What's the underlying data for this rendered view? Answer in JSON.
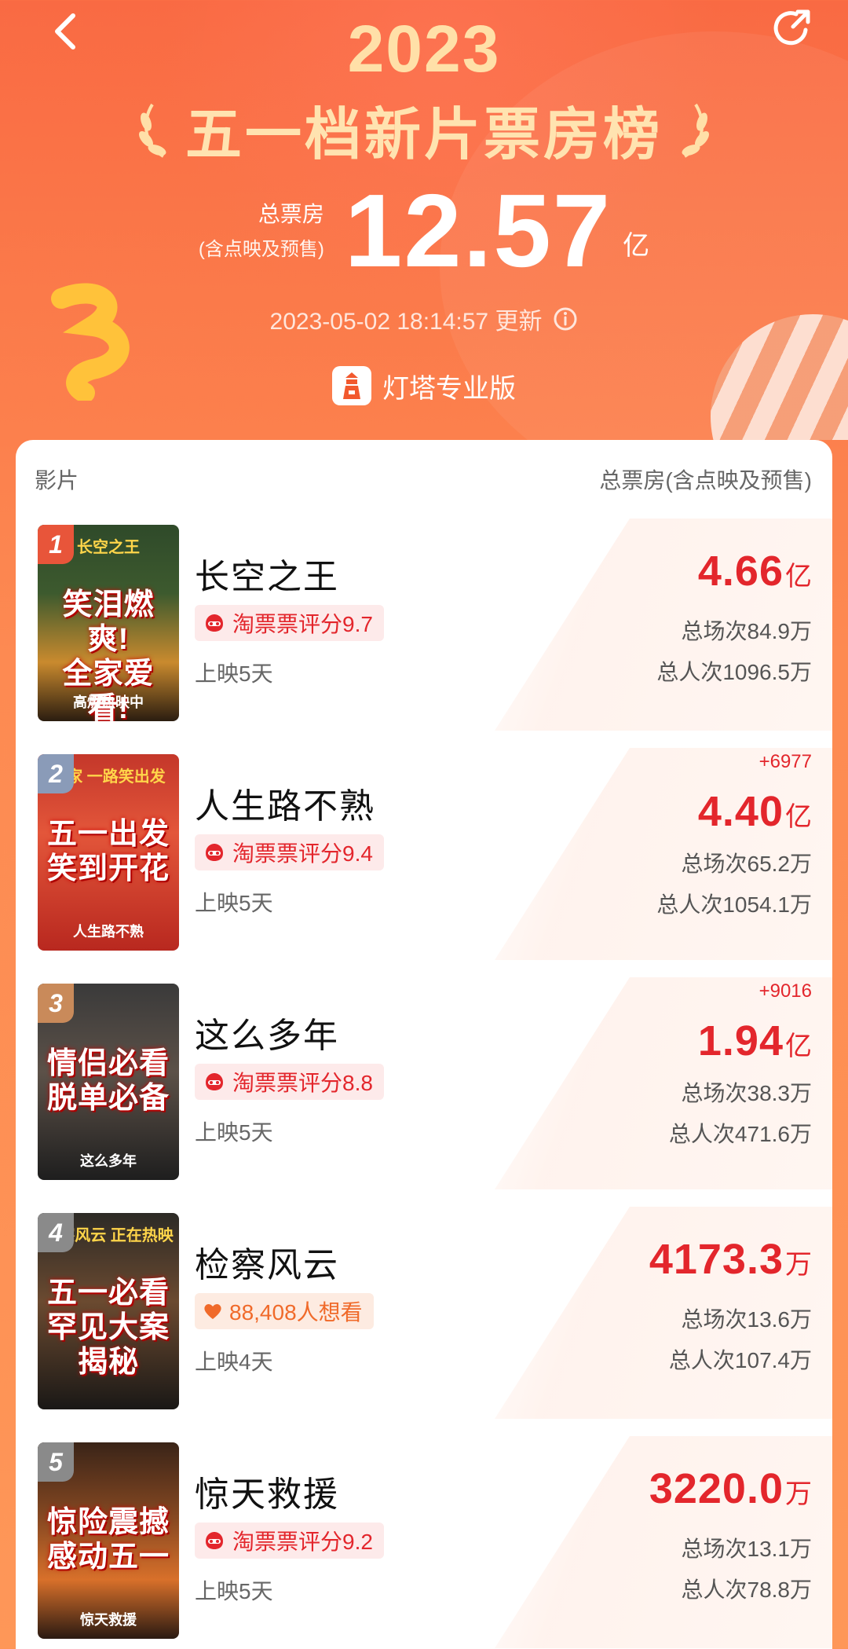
{
  "header": {
    "year": "2023",
    "title": "五一档新片票房榜",
    "total_label": "总票房",
    "total_sublabel": "(含点映及预售)",
    "total_value": "12.57",
    "total_unit": "亿",
    "updated": "2023-05-02 18:14:57 更新",
    "brand": "灯塔专业版"
  },
  "list": {
    "col_film": "影片",
    "col_gross": "总票房(含点映及预售)",
    "movies": [
      {
        "rank": "1",
        "rank_color": "#e8553a",
        "title": "长空之王",
        "badge": "淘票票评分9.7",
        "badge_type": "rating",
        "days": "上映5天",
        "delta": "",
        "gross": "4.66",
        "gross_unit": "亿",
        "shows": "总场次84.9万",
        "admissions": "总人次1096.5万",
        "poster": {
          "top": "长空之王",
          "text": "笑泪燃爽!\n全家爱看!",
          "sub": "高燃热映中"
        }
      },
      {
        "rank": "2",
        "rank_color": "#8a9bb8",
        "title": "人生路不熟",
        "badge": "淘票票评分9.4",
        "badge_type": "rating",
        "days": "上映5天",
        "delta": "+6977",
        "gross": "4.40",
        "gross_unit": "亿",
        "shows": "总场次65.2万",
        "admissions": "总人次1054.1万",
        "poster": {
          "top": "一家 一路笑出发",
          "text": "五一出发\n笑到开花",
          "sub": "人生路不熟"
        }
      },
      {
        "rank": "3",
        "rank_color": "#c98a5a",
        "title": "这么多年",
        "badge": "淘票票评分8.8",
        "badge_type": "rating",
        "days": "上映5天",
        "delta": "+9016",
        "gross": "1.94",
        "gross_unit": "亿",
        "shows": "总场次38.3万",
        "admissions": "总人次471.6万",
        "poster": {
          "top": "",
          "text": "情侣必看\n脱单必备",
          "sub": "这么多年"
        }
      },
      {
        "rank": "4",
        "rank_color": "#8a8a8a",
        "title": "检察风云",
        "badge": "88,408人想看",
        "badge_type": "want",
        "days": "上映4天",
        "delta": "",
        "gross": "4173.3",
        "gross_unit": "万",
        "shows": "总场次13.6万",
        "admissions": "总人次107.4万",
        "poster": {
          "top": "检察风云 正在热映",
          "text": "五一必看\n罕见大案揭秘",
          "sub": ""
        }
      },
      {
        "rank": "5",
        "rank_color": "#8a8a8a",
        "title": "惊天救援",
        "badge": "淘票票评分9.2",
        "badge_type": "rating",
        "days": "上映5天",
        "delta": "",
        "gross": "3220.0",
        "gross_unit": "万",
        "shows": "总场次13.1万",
        "admissions": "总人次78.8万",
        "poster": {
          "top": "",
          "text": "惊险震撼\n感动五一",
          "sub": "惊天救援"
        }
      }
    ]
  }
}
